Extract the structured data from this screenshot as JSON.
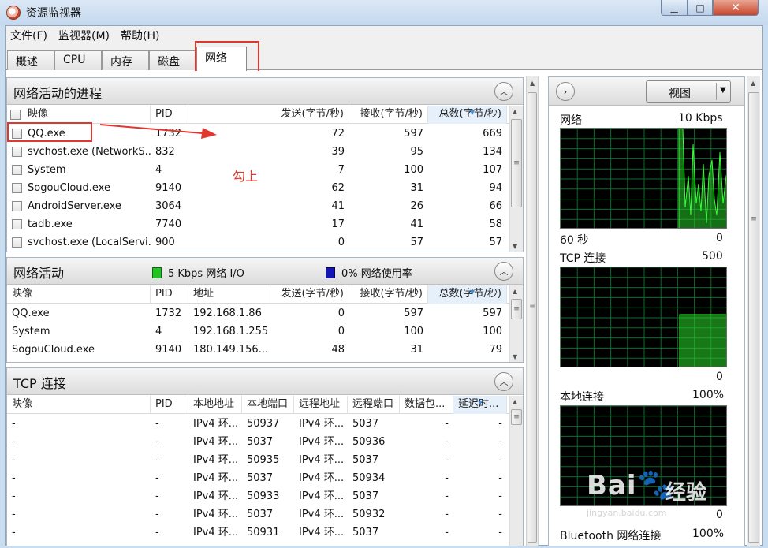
{
  "window": {
    "title": "资源监视器",
    "close_label": "✕",
    "min_label": "▁",
    "max_label": "□"
  },
  "menu": [
    "文件(F)",
    "监视器(M)",
    "帮助(H)"
  ],
  "tabs": [
    {
      "label": "概述",
      "active": false
    },
    {
      "label": "CPU",
      "active": false
    },
    {
      "label": "内存",
      "active": false
    },
    {
      "label": "磁盘",
      "active": false
    },
    {
      "label": "网络",
      "active": true
    }
  ],
  "processes": {
    "title": "网络活动的进程",
    "columns": [
      "映像",
      "PID",
      "发送(字节/秒)",
      "接收(字节/秒)",
      "总数(字节/秒)"
    ],
    "rows": [
      {
        "name": "QQ.exe",
        "pid": "1732",
        "send": "72",
        "recv": "597",
        "total": "669"
      },
      {
        "name": "svchost.exe (NetworkS...",
        "pid": "832",
        "send": "39",
        "recv": "95",
        "total": "134"
      },
      {
        "name": "System",
        "pid": "4",
        "send": "7",
        "recv": "100",
        "total": "107"
      },
      {
        "name": "SogouCloud.exe",
        "pid": "9140",
        "send": "62",
        "recv": "31",
        "total": "94"
      },
      {
        "name": "AndroidServer.exe",
        "pid": "3064",
        "send": "41",
        "recv": "26",
        "total": "66"
      },
      {
        "name": "tadb.exe",
        "pid": "7740",
        "send": "17",
        "recv": "41",
        "total": "58"
      },
      {
        "name": "svchost.exe (LocalServi...",
        "pid": "900",
        "send": "0",
        "recv": "57",
        "total": "57"
      }
    ]
  },
  "annotation": {
    "text": "勾上"
  },
  "activity": {
    "title": "网络活动",
    "legend_io": "5 Kbps 网络 I/O",
    "legend_usage": "0% 网络使用率",
    "io_color": "#22c322",
    "usage_color": "#1414b4",
    "columns": [
      "映像",
      "PID",
      "地址",
      "发送(字节/秒)",
      "接收(字节/秒)",
      "总数(字节/秒)"
    ],
    "rows": [
      {
        "name": "QQ.exe",
        "pid": "1732",
        "addr": "192.168.1.86",
        "send": "0",
        "recv": "597",
        "total": "597"
      },
      {
        "name": "System",
        "pid": "4",
        "addr": "192.168.1.255",
        "send": "0",
        "recv": "100",
        "total": "100"
      },
      {
        "name": "SogouCloud.exe",
        "pid": "9140",
        "addr": "180.149.156...",
        "send": "48",
        "recv": "31",
        "total": "79"
      }
    ]
  },
  "tcp": {
    "title": "TCP 连接",
    "columns": [
      "映像",
      "PID",
      "本地地址",
      "本地端口",
      "远程地址",
      "远程端口",
      "数据包...",
      "延迟时..."
    ],
    "rows": [
      {
        "name": "-",
        "pid": "-",
        "laddr": "IPv4 环...",
        "lport": "50937",
        "raddr": "IPv4 环...",
        "rport": "5037",
        "loss": "-",
        "lat": "-"
      },
      {
        "name": "-",
        "pid": "-",
        "laddr": "IPv4 环...",
        "lport": "5037",
        "raddr": "IPv4 环...",
        "rport": "50936",
        "loss": "-",
        "lat": "-"
      },
      {
        "name": "-",
        "pid": "-",
        "laddr": "IPv4 环...",
        "lport": "50935",
        "raddr": "IPv4 环...",
        "rport": "5037",
        "loss": "-",
        "lat": "-"
      },
      {
        "name": "-",
        "pid": "-",
        "laddr": "IPv4 环...",
        "lport": "5037",
        "raddr": "IPv4 环...",
        "rport": "50934",
        "loss": "-",
        "lat": "-"
      },
      {
        "name": "-",
        "pid": "-",
        "laddr": "IPv4 环...",
        "lport": "50933",
        "raddr": "IPv4 环...",
        "rport": "5037",
        "loss": "-",
        "lat": "-"
      },
      {
        "name": "-",
        "pid": "-",
        "laddr": "IPv4 环...",
        "lport": "5037",
        "raddr": "IPv4 环...",
        "rport": "50932",
        "loss": "-",
        "lat": "-"
      },
      {
        "name": "-",
        "pid": "-",
        "laddr": "IPv4 环...",
        "lport": "50931",
        "raddr": "IPv4 环...",
        "rport": "5037",
        "loss": "-",
        "lat": "-"
      }
    ]
  },
  "right_panel": {
    "view_label": "视图",
    "network": {
      "title": "网络",
      "max": "10 Kbps",
      "time": "60 秒",
      "min": "0"
    },
    "tcp": {
      "title": "TCP 连接",
      "max": "500",
      "min": "0"
    },
    "local": {
      "title": "本地连接",
      "max": "100%",
      "min": "0"
    },
    "bluetooth": {
      "title": "Bluetooth 网络连接",
      "max": "100%"
    }
  },
  "watermark": {
    "brand": "Bai",
    "jy": "经验",
    "url": "jingyan.baidu.com"
  }
}
